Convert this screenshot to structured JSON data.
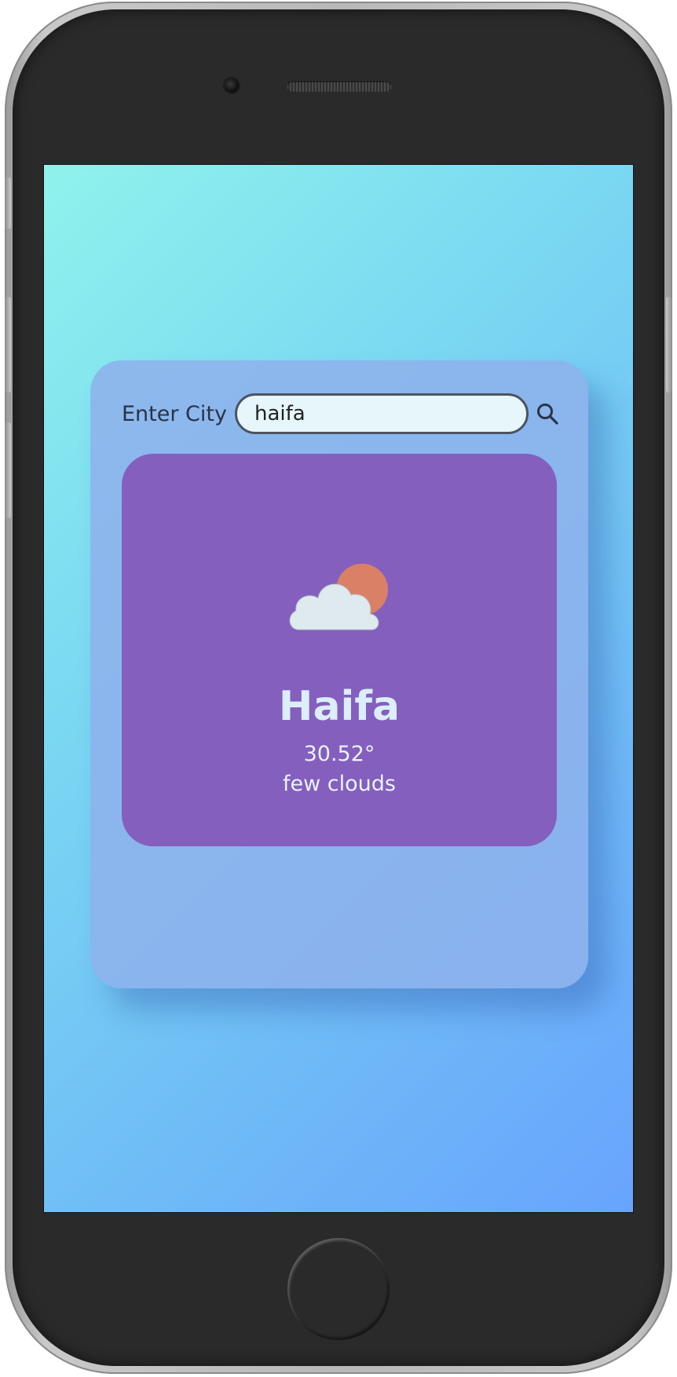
{
  "search": {
    "label": "Enter City",
    "value": "haifa",
    "placeholder": ""
  },
  "weather": {
    "icon": "partly-cloudy-icon",
    "city": "Haifa",
    "temperature": "30.52°",
    "description": "few clouds"
  },
  "colors": {
    "screen_gradient_start": "#8ff3ec",
    "screen_gradient_end": "#68a4fd",
    "app_card": "#8db2ec",
    "weather_card": "#845fbe",
    "sun": "#d98067",
    "cloud": "#dfeaef",
    "city_text": "#dceefa"
  }
}
